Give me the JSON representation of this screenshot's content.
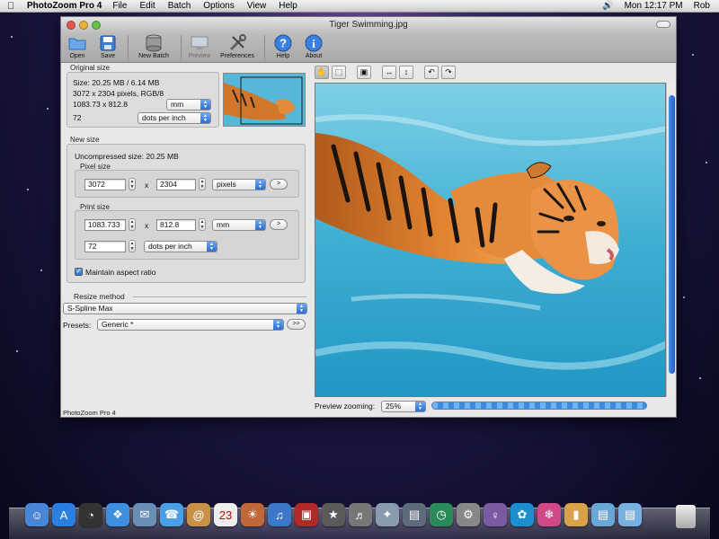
{
  "menubar": {
    "app": "PhotoZoom Pro 4",
    "items": [
      "File",
      "Edit",
      "Batch",
      "Options",
      "View",
      "Help"
    ],
    "clock": "Mon 12:17 PM",
    "user": "Rob"
  },
  "window": {
    "title": "Tiger Swimming.jpg"
  },
  "toolbar": {
    "open": "Open",
    "save": "Save",
    "new_batch": "New Batch",
    "preview": "Preview",
    "preferences": "Preferences",
    "help": "Help",
    "about": "About"
  },
  "original": {
    "label": "Original size",
    "size": "Size: 20.25 MB / 6.14 MB",
    "pixels": "3072 x 2304 pixels, RGB/8",
    "print": "1083.73 x 812.8",
    "print_unit": "mm",
    "resolution": "72",
    "resolution_unit": "dots per inch"
  },
  "new_size": {
    "label": "New size",
    "uncompressed": "Uncompressed size: 20.25 MB",
    "pixel_label": "Pixel size",
    "pixel_width": "3072",
    "pixel_height": "2304",
    "x": "x",
    "pixel_unit": "pixels",
    "print_label": "Print size",
    "print_width": "1083.733",
    "print_height": "812.8",
    "print_unit": "mm",
    "resolution": "72",
    "resolution_unit": "dots per inch",
    "arrow_btn": ">",
    "aspect": "Maintain aspect ratio"
  },
  "resize": {
    "label": "Resize method",
    "method": "S-Spline Max",
    "presets_label": "Presets:",
    "preset": "Generic *",
    "more": ">>"
  },
  "preview": {
    "zoom_label": "Preview zooming:",
    "zoom_value": "25%"
  },
  "status": "PhotoZoom Pro 4"
}
